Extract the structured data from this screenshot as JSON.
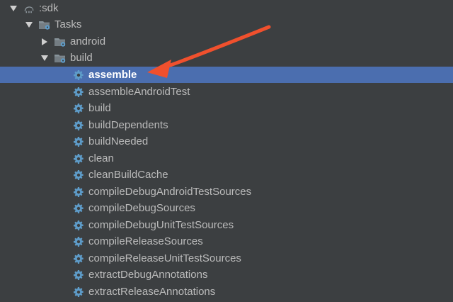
{
  "tree": {
    "root": {
      "label": ":sdk",
      "icon": "elephant-gradle-icon",
      "expanded": true
    },
    "tasks": {
      "label": "Tasks",
      "icon": "task-folder-icon",
      "expanded": true
    },
    "groups": [
      {
        "label": "android",
        "icon": "task-folder-icon",
        "expanded": false
      },
      {
        "label": "build",
        "icon": "task-folder-icon",
        "expanded": true
      }
    ],
    "tasks_in_build": [
      {
        "label": "assemble",
        "icon": "gear-icon",
        "selected": true
      },
      {
        "label": "assembleAndroidTest",
        "icon": "gear-icon"
      },
      {
        "label": "build",
        "icon": "gear-icon"
      },
      {
        "label": "buildDependents",
        "icon": "gear-icon"
      },
      {
        "label": "buildNeeded",
        "icon": "gear-icon"
      },
      {
        "label": "clean",
        "icon": "gear-icon"
      },
      {
        "label": "cleanBuildCache",
        "icon": "gear-icon"
      },
      {
        "label": "compileDebugAndroidTestSources",
        "icon": "gear-icon"
      },
      {
        "label": "compileDebugSources",
        "icon": "gear-icon"
      },
      {
        "label": "compileDebugUnitTestSources",
        "icon": "gear-icon"
      },
      {
        "label": "compileReleaseSources",
        "icon": "gear-icon"
      },
      {
        "label": "compileReleaseUnitTestSources",
        "icon": "gear-icon"
      },
      {
        "label": "extractDebugAnnotations",
        "icon": "gear-icon"
      },
      {
        "label": "extractReleaseAnnotations",
        "icon": "gear-icon"
      }
    ]
  },
  "colors": {
    "background": "#3c3f41",
    "selection": "#4b6eaf",
    "text": "#bbbbbb",
    "selected_text": "#ffffff",
    "gear": "#5e9cc9",
    "annotation_arrow": "#f0502d"
  }
}
